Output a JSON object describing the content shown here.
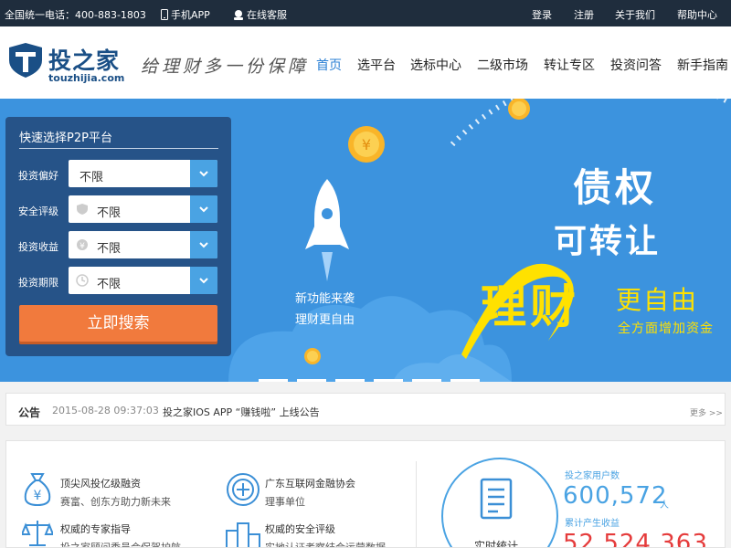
{
  "topbar": {
    "hotline": "全国统一电话：400-883-1803",
    "mobile_app": "手机APP",
    "online_service": "在线客服",
    "login": "登录",
    "register": "注册",
    "about": "关于我们",
    "help": "帮助中心"
  },
  "header": {
    "logo_cn": "投之家",
    "logo_en": "touzhijia.com",
    "slogan": "给理财多一份保障",
    "nav": [
      "首页",
      "选平台",
      "选标中心",
      "二级市场",
      "转让专区",
      "投资问答",
      "新手指南"
    ],
    "active_index": 0
  },
  "search_panel": {
    "title": "快速选择P2P平台",
    "filters": [
      {
        "label": "投资偏好",
        "value": "不限",
        "icon": "none"
      },
      {
        "label": "安全评级",
        "value": "不限",
        "icon": "shield-icon"
      },
      {
        "label": "投资收益",
        "value": "不限",
        "icon": "yen-icon"
      },
      {
        "label": "投资期限",
        "value": "不限",
        "icon": "clock-icon"
      }
    ],
    "button": "立即搜索"
  },
  "banner": {
    "rocket_line1": "新功能来袭",
    "rocket_line2": "理财更自由",
    "headline1": "债权",
    "headline2": "可转让",
    "headline3": "理财",
    "headline4": "更自由",
    "headline5": "全方面增加资金",
    "slide_count": 6,
    "colors": {
      "background": "#3c93de",
      "accent": "#ffe100"
    }
  },
  "notice": {
    "label": "公告",
    "date": "2015-08-28 09:37:03",
    "title": "投之家IOS APP “赚钱啦” 上线公告",
    "more": "更多 >>"
  },
  "features": [
    {
      "title": "顶尖风投亿级融资",
      "subtitle": "赛富、创东方助力新未来",
      "icon": "money-bag-icon"
    },
    {
      "title": "广东互联网金融协会",
      "subtitle": "理事单位",
      "icon": "association-seal-icon"
    },
    {
      "title": "权威的专家指导",
      "subtitle": "投之家顾问委员会保驾护航",
      "icon": "scale-icon"
    },
    {
      "title": "权威的安全评级",
      "subtitle": "实地认证考察结合运营数据",
      "icon": "podium-icon"
    }
  ],
  "stats": {
    "circle_label": "实时统计",
    "users_label": "投之家用户数",
    "users_value": "600,572",
    "users_unit": "人",
    "earnings_label": "累计产生收益",
    "earnings_value": "52,524,363"
  }
}
